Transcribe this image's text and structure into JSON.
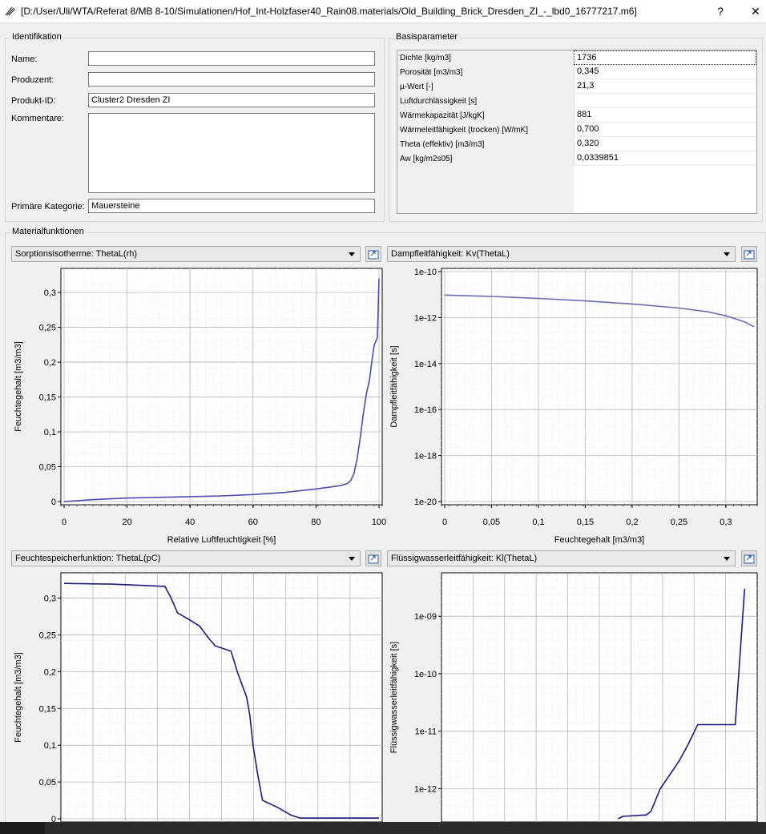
{
  "window": {
    "title": "[D:/User/Uli/WTA/Referat 8/MB 8-10/Simulationen/Hof_Int-Holzfaser40_Rain08.materials/Old_Building_Brick_Dresden_ZI_-_lbd0_16777217.m6]",
    "help_label": "?",
    "close_label": "✕"
  },
  "identifikation": {
    "group_label": "Identifikation",
    "name_label": "Name:",
    "name_value": "",
    "produzent_label": "Produzent:",
    "produzent_value": "",
    "produkt_id_label": "Produkt-ID:",
    "produkt_id_value": "Cluster2 Dresden ZI",
    "kommentare_label": "Kommentare:",
    "kommentare_value": "",
    "kategorie_label": "Primäre Kategorie:",
    "kategorie_value": "Mauersteine"
  },
  "basisparameter": {
    "group_label": "Basisparameter",
    "rows": [
      {
        "key": "Dichte [kg/m3]",
        "value": "1736"
      },
      {
        "key": "Porosität [m3/m3]",
        "value": "0,345"
      },
      {
        "key": "µ-Wert [-]",
        "value": "21,3"
      },
      {
        "key": "Luftdurchlässigkeit [s]",
        "value": ""
      },
      {
        "key": "Wärmekapazität [J/kgK]",
        "value": "881"
      },
      {
        "key": "Wärmeleitfähigkeit (trocken) [W/mK]",
        "value": "0,700"
      },
      {
        "key": "Theta (effektiv) [m3/m3]",
        "value": "0,320"
      },
      {
        "key": "Aw [kg/m2s05]",
        "value": "0,0339851"
      }
    ]
  },
  "materialfunktionen": {
    "group_label": "Materialfunktionen",
    "combo1": "Sorptionsisotherme: ThetaL(rh)",
    "combo2": "Dampfleitfähigkeit: Kv(ThetaL)",
    "combo3": "Feuchtespeicherfunktion: ThetaL(pC)",
    "combo4": "Flüssigwasserleitfähigkeit: Kl(ThetaL)"
  },
  "chart_data": [
    {
      "type": "line",
      "xlabel": "Relative Luftfeuchtigkeit [%]",
      "ylabel": "Feuchtegehalt [m3/m3]",
      "xlim": [
        0,
        100
      ],
      "ylim": [
        0,
        0.33
      ],
      "xticks": [
        "0",
        "20",
        "40",
        "60",
        "80",
        "100"
      ],
      "yticks": [
        "0",
        "0,05",
        "0,1",
        "0,15",
        "0,2",
        "0,25",
        "0,3"
      ],
      "grid": true,
      "color": "#4b4bb0",
      "series": [
        {
          "x": [
            0,
            10,
            20,
            30,
            40,
            50,
            60,
            70,
            80,
            85,
            88,
            90,
            91,
            92,
            93,
            94,
            95,
            96,
            97,
            98,
            98.5,
            99,
            99.5,
            100
          ],
          "y": [
            0,
            0.003,
            0.005,
            0.006,
            0.007,
            0.008,
            0.01,
            0.013,
            0.018,
            0.021,
            0.023,
            0.026,
            0.03,
            0.04,
            0.06,
            0.09,
            0.125,
            0.155,
            0.175,
            0.21,
            0.225,
            0.23,
            0.235,
            0.32
          ]
        }
      ]
    },
    {
      "type": "line",
      "xlabel": "Feuchtegehalt [m3/m3]",
      "ylabel": "Dampfleitfähigkeit [s]",
      "xlim": [
        0,
        0.33
      ],
      "yscale": "log",
      "ylim": [
        1e-20,
        1e-10
      ],
      "xticks": [
        "0",
        "0,05",
        "0,1",
        "0,15",
        "0,2",
        "0,25",
        "0,3"
      ],
      "yticks": [
        "1e-20",
        "1e-18",
        "1e-16",
        "1e-14",
        "1e-12",
        "1e-10"
      ],
      "grid": true,
      "color": "#6a6ab4",
      "series": [
        {
          "x": [
            0,
            0.05,
            0.1,
            0.15,
            0.2,
            0.25,
            0.28,
            0.3,
            0.32,
            0.33
          ],
          "y": [
            9.5e-12,
            8.3e-12,
            6.8e-12,
            5.3e-12,
            3.9e-12,
            2.6e-12,
            1.8e-12,
            1.2e-12,
            6.5e-13,
            4e-13
          ]
        }
      ]
    },
    {
      "type": "line",
      "ylabel": "Feuchtegehalt [m3/m3]",
      "ylim": [
        0,
        0.33
      ],
      "xlim": [
        0,
        10
      ],
      "yticks": [
        "0",
        "0,05",
        "0,1",
        "0,15",
        "0,2",
        "0,25",
        "0,3"
      ],
      "grid": true,
      "color": "#1a1a7c",
      "series": [
        {
          "x": [
            0,
            1.5,
            3.2,
            3.4,
            3.6,
            4.0,
            4.3,
            4.6,
            4.8,
            5.3,
            5.5,
            5.8,
            5.9,
            6.0,
            6.15,
            6.3,
            6.8,
            7.2,
            7.5,
            10
          ],
          "y": [
            0.32,
            0.319,
            0.316,
            0.3,
            0.28,
            0.27,
            0.262,
            0.245,
            0.235,
            0.228,
            0.2,
            0.165,
            0.14,
            0.1,
            0.06,
            0.025,
            0.015,
            0.005,
            0.001,
            0.001
          ]
        }
      ]
    },
    {
      "type": "line",
      "ylabel": "Flüssigwasserleitfähigkeit [s]",
      "yscale": "log",
      "ylim": [
        3e-13,
        5e-09
      ],
      "xlim": [
        0,
        0.33
      ],
      "yticks": [
        "1e-12",
        "1e-11",
        "1e-10",
        "1e-09"
      ],
      "grid": true,
      "color": "#1a1a7c",
      "series": [
        {
          "x": [
            0.185,
            0.19,
            0.215,
            0.22,
            0.23,
            0.25,
            0.26,
            0.27,
            0.3,
            0.31,
            0.315,
            0.32
          ],
          "y": [
            3e-13,
            3.3e-13,
            3.5e-13,
            4e-13,
            1e-12,
            3e-12,
            6e-12,
            1.3e-11,
            1.3e-11,
            1.3e-11,
            2e-10,
            3e-09
          ]
        }
      ]
    }
  ]
}
